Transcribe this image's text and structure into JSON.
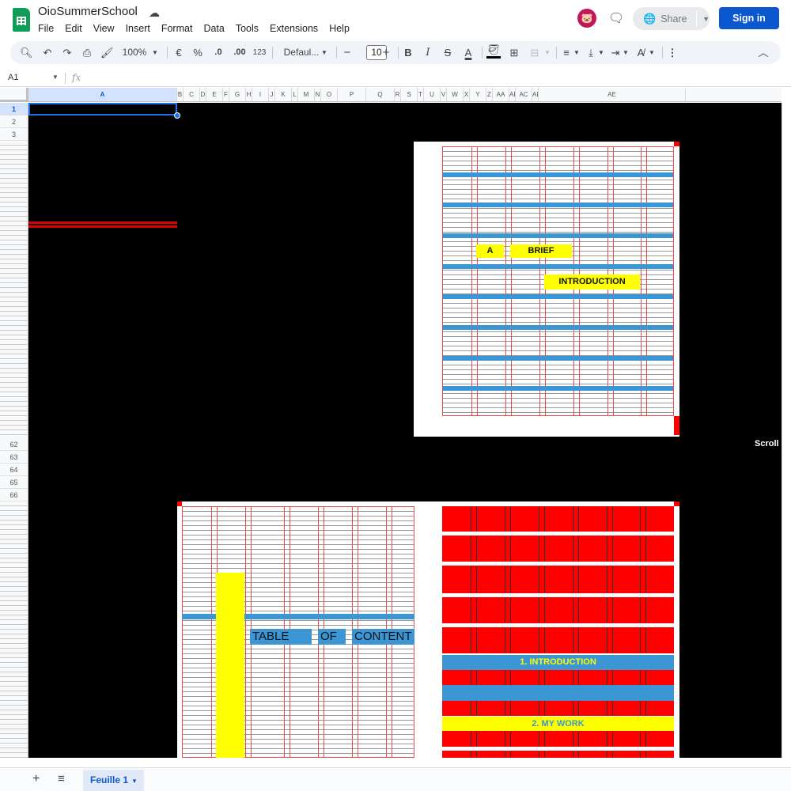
{
  "app": {
    "doc_title": "OioSummerSchool",
    "avatar_glyph": "🐷"
  },
  "menu": [
    "File",
    "Edit",
    "View",
    "Insert",
    "Format",
    "Data",
    "Tools",
    "Extensions",
    "Help"
  ],
  "header": {
    "share_label": "Share",
    "signin_label": "Sign in"
  },
  "toolbar": {
    "zoom": "100%",
    "currency": "€",
    "percent": "%",
    "dec_decrease": ".0",
    "dec_increase": ".00",
    "more_formats": "123",
    "font_family": "Defaul...",
    "font_size": "10",
    "minus": "−",
    "plus": "+",
    "bold": "B",
    "italic": "I",
    "strike": "S",
    "text_color": "A"
  },
  "formula_bar": {
    "cell_ref": "A1",
    "fx": "fx",
    "content": ""
  },
  "columns": [
    "A",
    "B",
    "C",
    "D",
    "E",
    "F",
    "G",
    "H",
    "I",
    "J",
    "K",
    "L",
    "M",
    "N",
    "O",
    "P",
    "Q",
    "R",
    "S",
    "T",
    "U",
    "V",
    "W",
    "X",
    "Y",
    "Z",
    "AA",
    "AB",
    "AC",
    "AD",
    "AE"
  ],
  "rows_labeled": [
    "1",
    "2",
    "3"
  ],
  "rows_mid": [
    "62",
    "63",
    "64",
    "65",
    "66"
  ],
  "sheet_content": {
    "scroll_label": "Scroll",
    "intro_tag_a": "A",
    "intro_tag_brief": "BRIEF",
    "intro_tag_introduction": "INTRODUCTION",
    "toc_table": "TABLE",
    "toc_of": "OF",
    "toc_content": "CONTENT",
    "toc_item_1": "1. INTRODUCTION",
    "toc_item_2": "2. MY WORK"
  },
  "sheets_bar": {
    "active_tab": "Feuille 1"
  },
  "colors": {
    "accent_blue": "#0b57d0",
    "sheet_bg": "#000000",
    "highlight_yellow": "#ffff00",
    "band_blue": "#3b96d3",
    "red": "#ff0000"
  }
}
